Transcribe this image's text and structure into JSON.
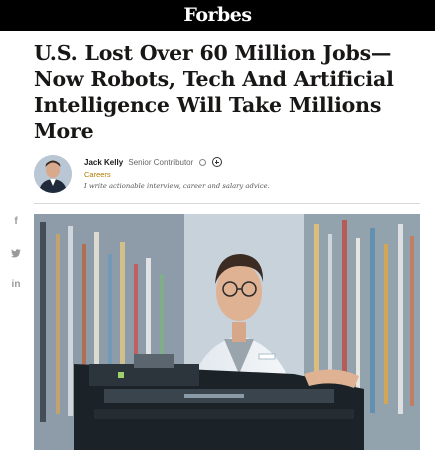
{
  "header": {
    "logo": "Forbes",
    "colors": {
      "bar": "#000000",
      "logo": "#ffffff"
    }
  },
  "article": {
    "headline_lines": [
      "U.S. Lost Over 60 Million Jobs—",
      "Now Robots, Tech And Artificial",
      "Intelligence Will Take Millions",
      "More"
    ],
    "author": {
      "name": "Jack Kelly",
      "role": "Senior Contributor",
      "category": "Careers",
      "tagline": "I write actionable interview, career and salary advice."
    },
    "hero_image": {
      "description_icon": "pharmacist-robot-photo"
    }
  },
  "share": {
    "icons": [
      "facebook-icon",
      "twitter-icon",
      "linkedin-icon"
    ],
    "glyphs": [
      "f",
      "•",
      "in"
    ]
  },
  "accent": {
    "category": "#b07b00"
  }
}
